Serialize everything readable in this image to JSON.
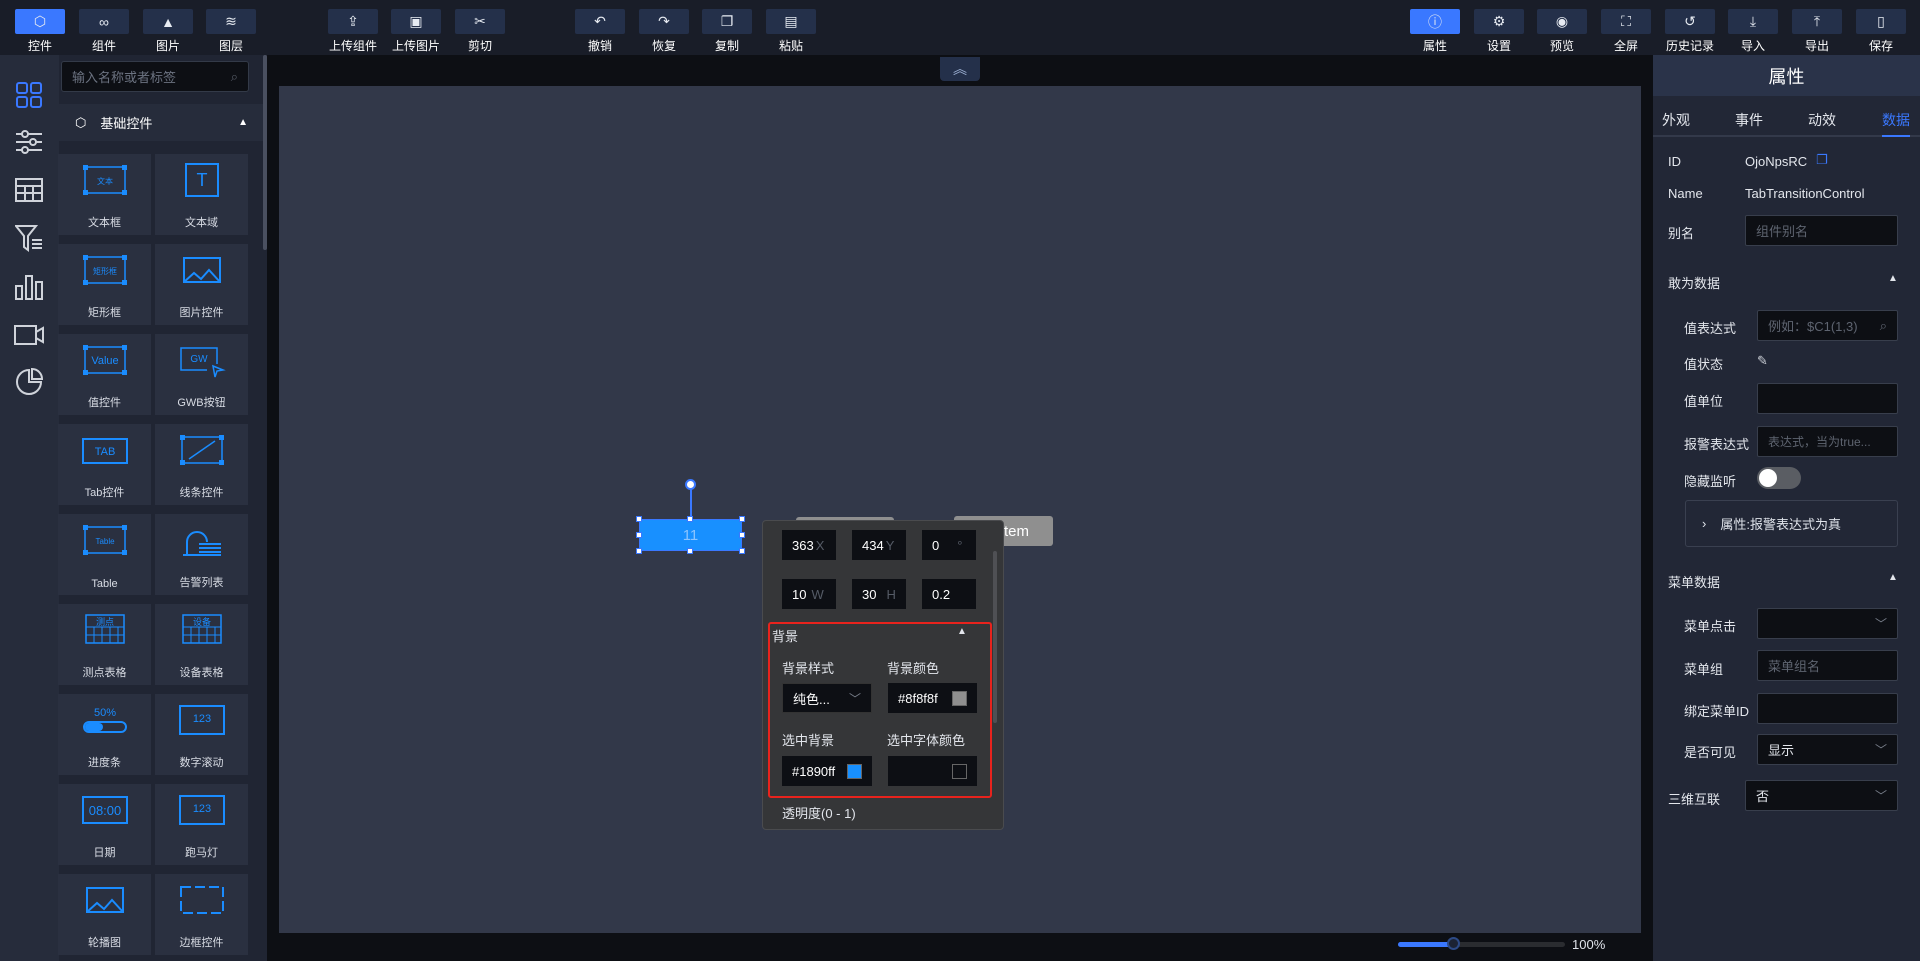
{
  "toolbar": {
    "left": [
      {
        "label": "控件",
        "icon": "cube-icon",
        "glyph": "⬡",
        "active": true
      },
      {
        "label": "组件",
        "icon": "link-icon",
        "glyph": "∞"
      },
      {
        "label": "图片",
        "icon": "image-icon",
        "glyph": "▲"
      },
      {
        "label": "图层",
        "icon": "layers-icon",
        "glyph": "≋"
      }
    ],
    "middle": [
      {
        "label": "上传组件",
        "icon": "upload-component-icon",
        "glyph": "⇪"
      },
      {
        "label": "上传图片",
        "icon": "upload-image-icon",
        "glyph": "▣"
      },
      {
        "label": "剪切",
        "icon": "cut-icon",
        "glyph": "✂"
      }
    ],
    "edit": [
      {
        "label": "撤销",
        "icon": "undo-icon",
        "glyph": "↶"
      },
      {
        "label": "恢复",
        "icon": "redo-icon",
        "glyph": "↷"
      },
      {
        "label": "复制",
        "icon": "copy-icon",
        "glyph": "❐"
      },
      {
        "label": "粘贴",
        "icon": "paste-icon",
        "glyph": "▤"
      }
    ],
    "right": [
      {
        "label": "属性",
        "icon": "info-icon",
        "glyph": "ⓘ",
        "active": true
      },
      {
        "label": "设置",
        "icon": "gear-icon",
        "glyph": "⚙"
      },
      {
        "label": "预览",
        "icon": "preview-icon",
        "glyph": "◉"
      },
      {
        "label": "全屏",
        "icon": "fullscreen-icon",
        "glyph": "⛶"
      },
      {
        "label": "历史记录",
        "icon": "history-icon",
        "glyph": "↺"
      },
      {
        "label": "导入",
        "icon": "import-icon",
        "glyph": "⤓"
      },
      {
        "label": "导出",
        "icon": "export-icon",
        "glyph": "⤒"
      },
      {
        "label": "保存",
        "icon": "save-icon",
        "glyph": "▯"
      }
    ]
  },
  "panel": {
    "search_placeholder": "输入名称或者标签",
    "group_title": "基础控件",
    "tiles": [
      {
        "label": "文本框",
        "icon": "textbox-icon",
        "art": "文本"
      },
      {
        "label": "文本域",
        "icon": "textarea-icon",
        "art": "T"
      },
      {
        "label": "矩形框",
        "icon": "rectangle-icon",
        "art": "矩形框"
      },
      {
        "label": "图片控件",
        "icon": "picture-icon",
        "art": ""
      },
      {
        "label": "值控件",
        "icon": "value-icon",
        "art": "Value"
      },
      {
        "label": "GWB按钮",
        "icon": "gwb-button-icon",
        "art": "GW"
      },
      {
        "label": "Tab控件",
        "icon": "tab-icon",
        "art": "TAB"
      },
      {
        "label": "线条控件",
        "icon": "line-icon",
        "art": ""
      },
      {
        "label": "Table",
        "icon": "table-icon",
        "art": "Table"
      },
      {
        "label": "告警列表",
        "icon": "alarm-list-icon",
        "art": ""
      },
      {
        "label": "测点表格",
        "icon": "point-table-icon",
        "art": "测点"
      },
      {
        "label": "设备表格",
        "icon": "device-table-icon",
        "art": "设备"
      },
      {
        "label": "进度条",
        "icon": "progress-icon",
        "art": "50%"
      },
      {
        "label": "数字滚动",
        "icon": "number-scroll-icon",
        "art": "123"
      },
      {
        "label": "日期",
        "icon": "date-icon",
        "art": "08:00"
      },
      {
        "label": "跑马灯",
        "icon": "marquee-icon",
        "art": "123"
      },
      {
        "label": "轮播图",
        "icon": "carousel-icon",
        "art": ""
      },
      {
        "label": "边框控件",
        "icon": "border-icon",
        "art": ""
      }
    ]
  },
  "canvas": {
    "selected_text": "11",
    "item_text": "tem",
    "zoom": "100%",
    "zoom_percent": 33
  },
  "popup": {
    "x": "363",
    "x_unit": "X",
    "y": "434",
    "y_unit": "Y",
    "rot": "0",
    "rot_unit": "°",
    "w": "10",
    "w_unit": "W",
    "h": "30",
    "h_unit": "H",
    "opacity_val": "0.2",
    "section": "背景",
    "bg_style_label": "背景样式",
    "bg_style_value": "纯色...",
    "bg_color_label": "背景颜色",
    "bg_color_value": "#8f8f8f",
    "sel_bg_label": "选中背景",
    "sel_bg_value": "#1890ff",
    "sel_font_label": "选中字体颜色",
    "opacity_label": "透明度(0 - 1)",
    "colors": {
      "bg": "#8f8f8f",
      "sel": "#1890ff"
    }
  },
  "right": {
    "title": "属性",
    "tabs": [
      "外观",
      "事件",
      "动效",
      "数据"
    ],
    "id_label": "ID",
    "id_value": "OjoNpsRC",
    "name_label": "Name",
    "name_value": "TabTransitionControl",
    "alias_label": "别名",
    "alias_placeholder": "组件别名",
    "data_section": "敢为数据",
    "expr_label": "值表达式",
    "expr_placeholder": "例如：$C1(1,3)",
    "state_label": "值状态",
    "unit_label": "值单位",
    "alarm_label": "报警表达式",
    "alarm_placeholder": "表达式，当为true...",
    "hide_label": "隐藏监听",
    "alarm_prop": "属性:报警表达式为真",
    "menu_section": "菜单数据",
    "menu_click_label": "菜单点击",
    "menu_group_label": "菜单组",
    "menu_group_placeholder": "菜单组名",
    "menu_id_label": "绑定菜单ID",
    "visible_label": "是否可见",
    "visible_value": "显示",
    "link3d_label": "三维互联",
    "link3d_value": "否"
  }
}
